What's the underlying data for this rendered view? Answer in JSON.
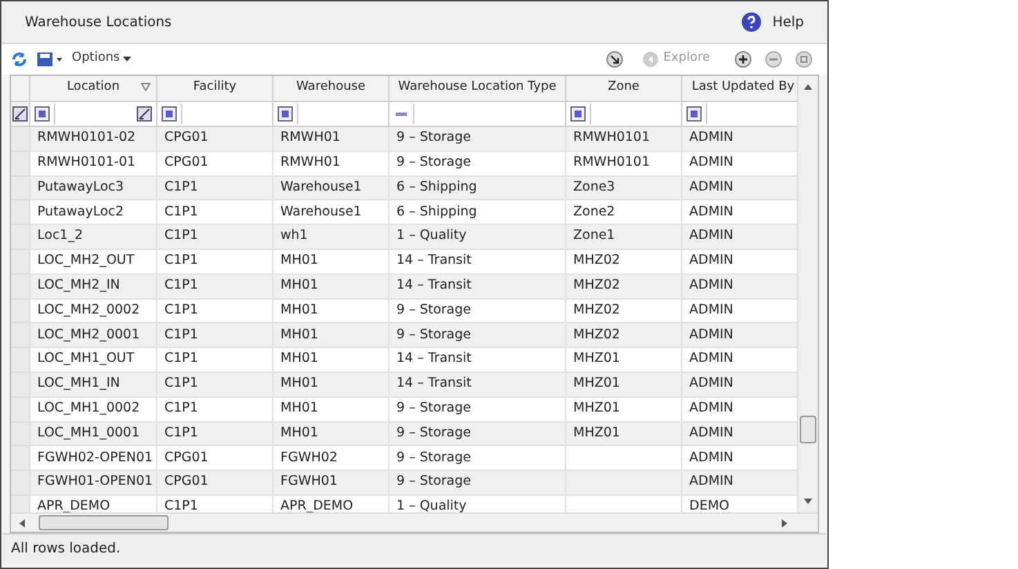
{
  "window": {
    "title": "Warehouse Locations",
    "help": "Help"
  },
  "toolbar": {
    "options": "Options",
    "explore": "Explore"
  },
  "table": {
    "columns": [
      {
        "label": "Location",
        "sorted": true,
        "kind": "list"
      },
      {
        "label": "Facility",
        "sorted": false,
        "kind": "list"
      },
      {
        "label": "Warehouse",
        "sorted": false,
        "kind": "list"
      },
      {
        "label": "Warehouse Location Type",
        "sorted": false,
        "kind": "enum"
      },
      {
        "label": "Zone",
        "sorted": false,
        "kind": "list"
      },
      {
        "label": "Last Updated By",
        "sorted": false,
        "kind": "list"
      }
    ],
    "rows": [
      [
        "RMWH0101-02",
        "CPG01",
        "RMWH01",
        "9 – Storage",
        "RMWH0101",
        "ADMIN"
      ],
      [
        "RMWH0101-01",
        "CPG01",
        "RMWH01",
        "9 – Storage",
        "RMWH0101",
        "ADMIN"
      ],
      [
        "PutawayLoc3",
        "C1P1",
        "Warehouse1",
        "6 – Shipping",
        "Zone3",
        "ADMIN"
      ],
      [
        "PutawayLoc2",
        "C1P1",
        "Warehouse1",
        "6 – Shipping",
        "Zone2",
        "ADMIN"
      ],
      [
        "Loc1_2",
        "C1P1",
        "wh1",
        "1 – Quality",
        "Zone1",
        "ADMIN"
      ],
      [
        "LOC_MH2_OUT",
        "C1P1",
        "MH01",
        "14 – Transit",
        "MHZ02",
        "ADMIN"
      ],
      [
        "LOC_MH2_IN",
        "C1P1",
        "MH01",
        "14 – Transit",
        "MHZ02",
        "ADMIN"
      ],
      [
        "LOC_MH2_0002",
        "C1P1",
        "MH01",
        "9 – Storage",
        "MHZ02",
        "ADMIN"
      ],
      [
        "LOC_MH2_0001",
        "C1P1",
        "MH01",
        "9 – Storage",
        "MHZ02",
        "ADMIN"
      ],
      [
        "LOC_MH1_OUT",
        "C1P1",
        "MH01",
        "14 – Transit",
        "MHZ01",
        "ADMIN"
      ],
      [
        "LOC_MH1_IN",
        "C1P1",
        "MH01",
        "14 – Transit",
        "MHZ01",
        "ADMIN"
      ],
      [
        "LOC_MH1_0002",
        "C1P1",
        "MH01",
        "9 – Storage",
        "MHZ01",
        "ADMIN"
      ],
      [
        "LOC_MH1_0001",
        "C1P1",
        "MH01",
        "9 – Storage",
        "MHZ01",
        "ADMIN"
      ],
      [
        "FGWH02-OPEN01",
        "CPG01",
        "FGWH02",
        "9 – Storage",
        null,
        "ADMIN"
      ],
      [
        "FGWH01-OPEN01",
        "CPG01",
        "FGWH01",
        "9 – Storage",
        null,
        "ADMIN"
      ],
      [
        "APR_DEMO",
        "C1P1",
        "APR_DEMO",
        "1 – Quality",
        null,
        "DEMO"
      ]
    ]
  },
  "status_bar": "All rows loaded."
}
